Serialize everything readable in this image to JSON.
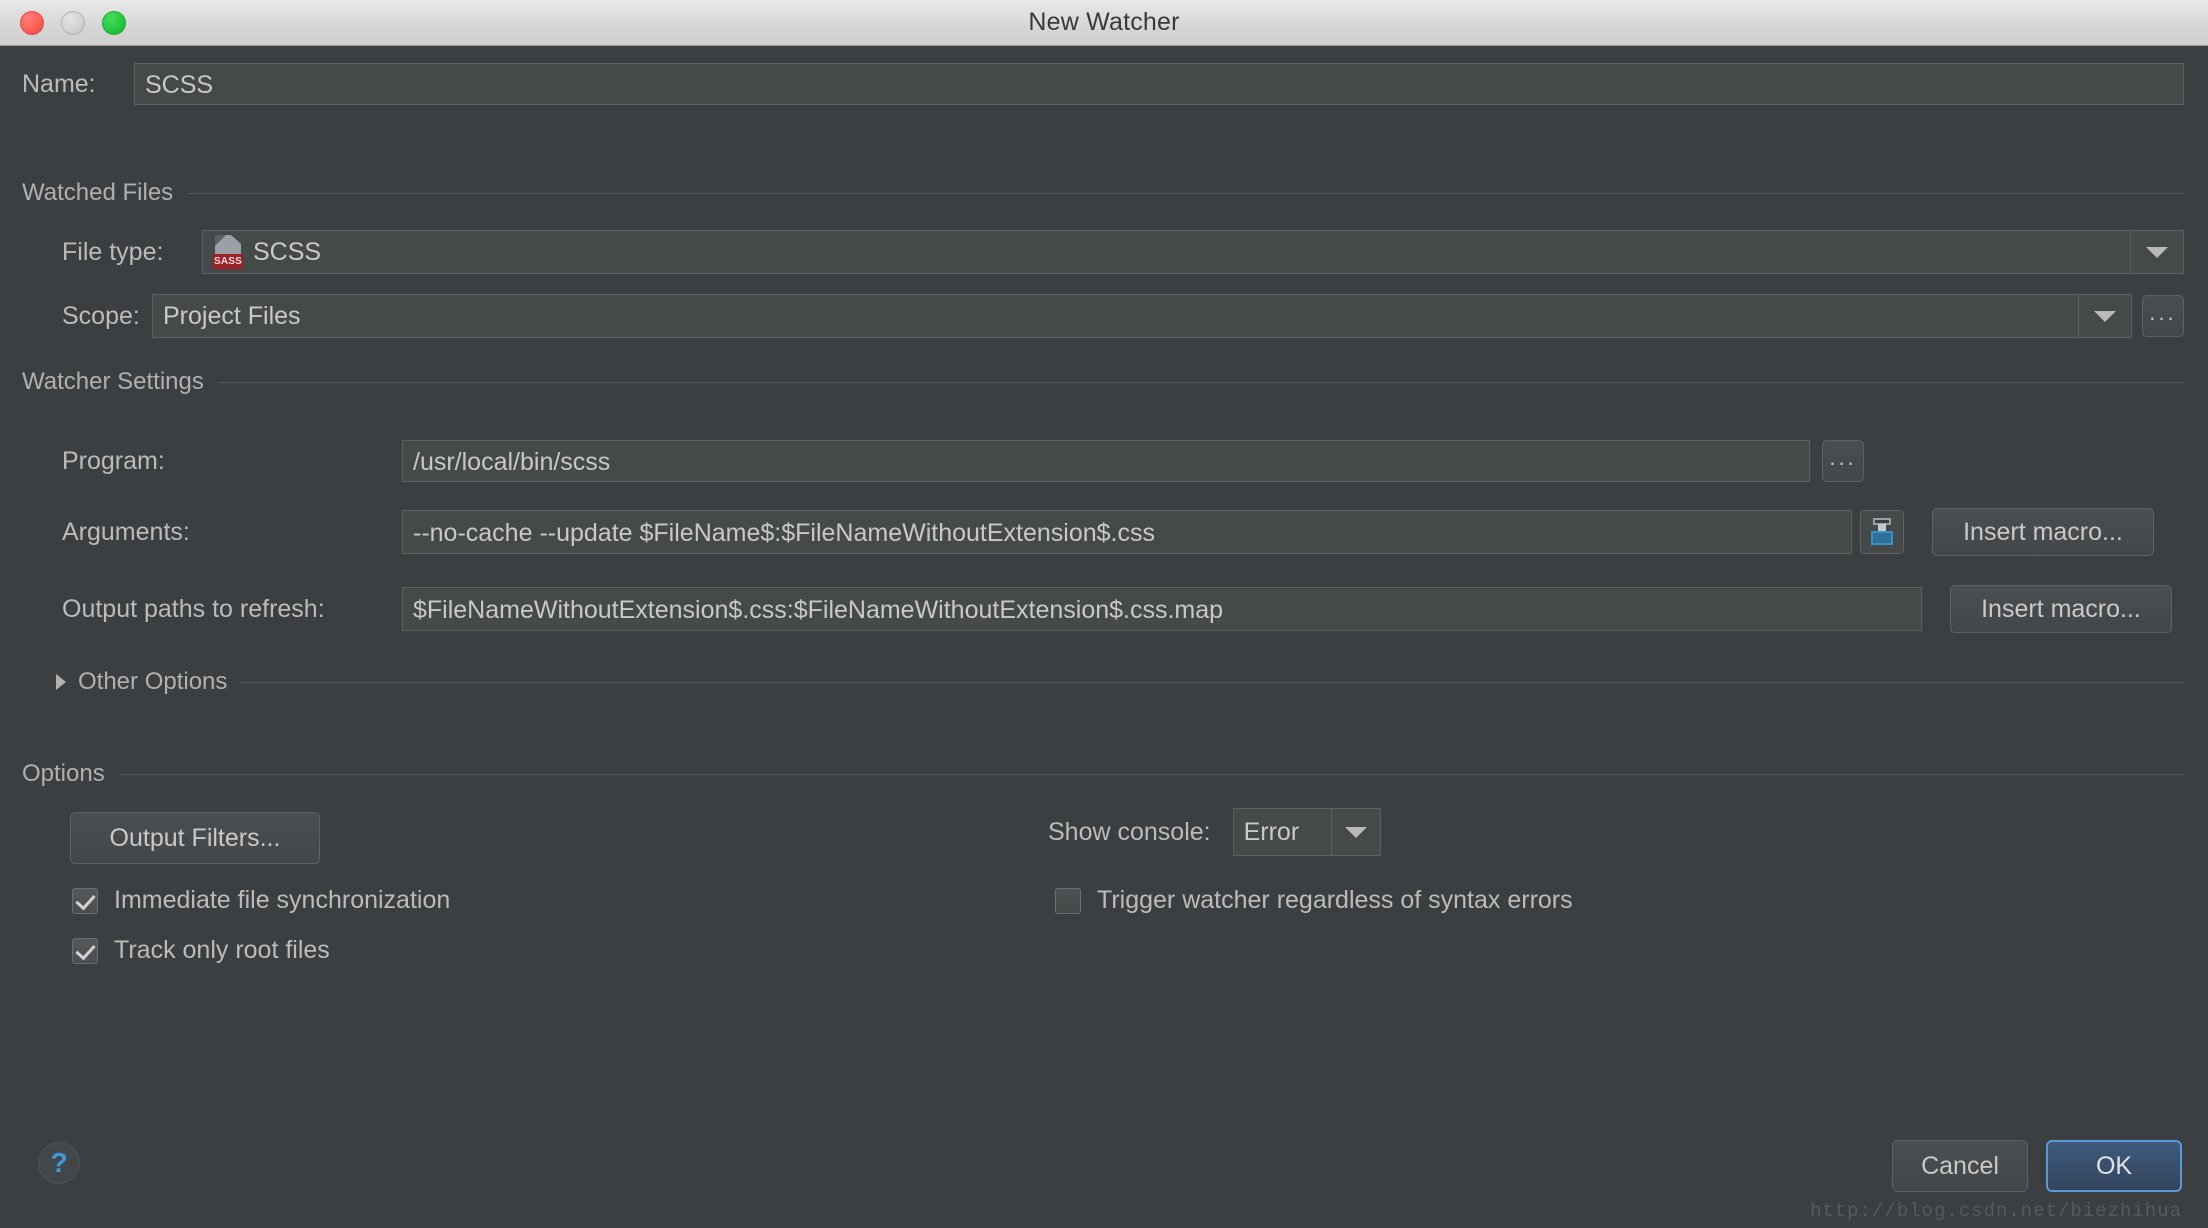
{
  "window": {
    "title": "New Watcher",
    "traffic_lights": [
      "close-red",
      "minimize-gray",
      "zoom-green"
    ]
  },
  "name_row": {
    "label": "Name:",
    "value": "SCSS"
  },
  "watched_files": {
    "group_title": "Watched Files",
    "file_type": {
      "label": "File type:",
      "value": "SCSS",
      "icon": "sass-file-icon",
      "icon_badge": "SASS"
    },
    "scope": {
      "label": "Scope:",
      "value": "Project Files",
      "browse_label": "..."
    }
  },
  "watcher_settings": {
    "group_title": "Watcher Settings",
    "program": {
      "label": "Program:",
      "value": "/usr/local/bin/scss",
      "browse_label": "..."
    },
    "arguments": {
      "label": "Arguments:",
      "value": "--no-cache --update $FileName$:$FileNameWithoutExtension$.css",
      "expand_icon": "insert-macro-icon",
      "insert_macro_label": "Insert macro..."
    },
    "output_paths": {
      "label": "Output paths to refresh:",
      "value": "$FileNameWithoutExtension$.css:$FileNameWithoutExtension$.css.map",
      "insert_macro_label": "Insert macro..."
    },
    "other_options": {
      "label": "Other Options",
      "expanded": false
    }
  },
  "options": {
    "group_title": "Options",
    "output_filters_label": "Output Filters...",
    "checkboxes": [
      {
        "label": "Immediate file synchronization",
        "checked": true
      },
      {
        "label": "Track only root files",
        "checked": true
      }
    ],
    "show_console": {
      "label": "Show console:",
      "value": "Error"
    },
    "trigger_watcher": {
      "label": "Trigger watcher regardless of syntax errors",
      "checked": false
    }
  },
  "footer": {
    "help_label": "?",
    "cancel_label": "Cancel",
    "ok_label": "OK",
    "watermark": "http://blog.csdn.net/biezhihua"
  },
  "colors": {
    "dialog_bg": "#3c3f41",
    "field_bg": "#45494a",
    "accent_blue": "#5b9bd5",
    "sass_red": "#9b2226",
    "help_blue": "#3c9ae0"
  }
}
